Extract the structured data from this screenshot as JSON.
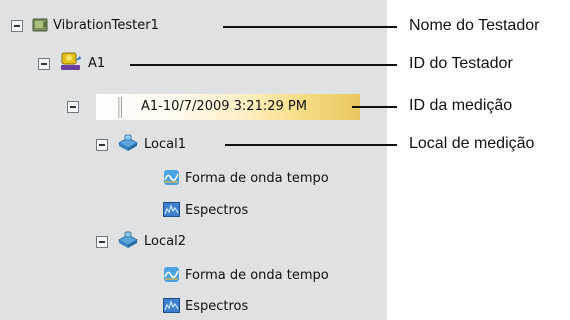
{
  "tree": {
    "root": {
      "label": "VibrationTester1"
    },
    "tester": {
      "label": "A1"
    },
    "measurement": {
      "label": "A1-10/7/2009 3:21:29 PM"
    },
    "location1": {
      "label": "Local1",
      "children": [
        "Forma de onda tempo",
        "Espectros"
      ]
    },
    "location2": {
      "label": "Local2",
      "children": [
        "Forma de onda tempo",
        "Espectros"
      ]
    }
  },
  "callouts": [
    {
      "label": "Nome do Testador"
    },
    {
      "label": "ID do Testador"
    },
    {
      "label": "ID da medição"
    },
    {
      "label": "Local de medição"
    }
  ],
  "colors": {
    "panel_background": "#dfe1e2",
    "selection_highlight": "#ebc65f"
  },
  "icons": {
    "root": "tester-device-icon",
    "tester": "tester-id-icon",
    "location": "measurement-location-icon",
    "waveform": "time-waveform-icon",
    "spectra": "spectrum-icon"
  }
}
